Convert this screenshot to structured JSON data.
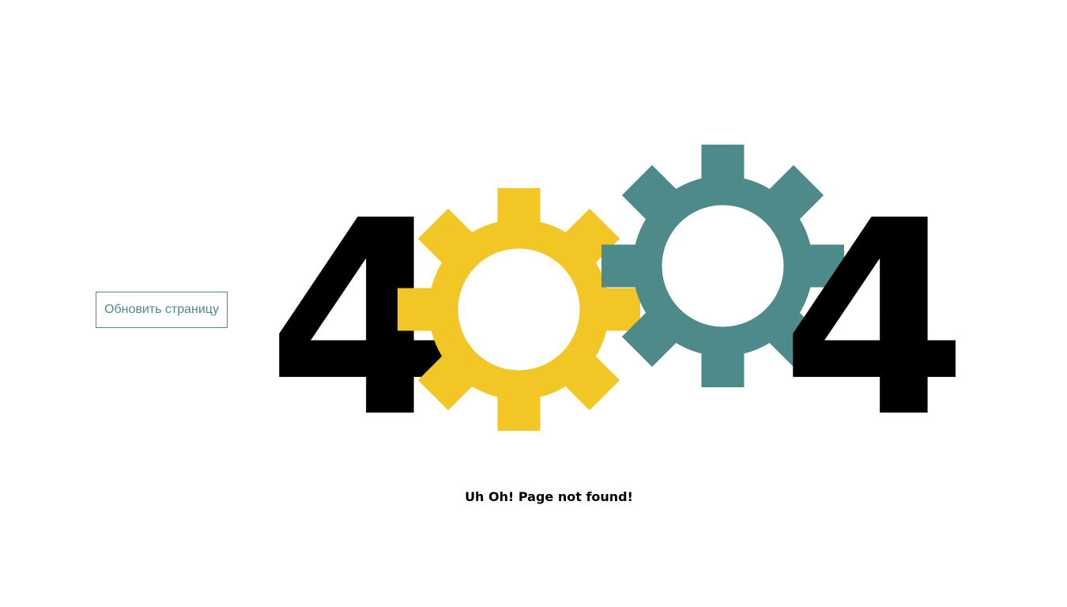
{
  "refresh_button": {
    "label": "Обновить страницу"
  },
  "error": {
    "digit_left": "4",
    "digit_right": "4",
    "message": "Uh Oh! Page not found!"
  },
  "gears": {
    "left": {
      "icon": "gear-icon",
      "color": "#f2c624"
    },
    "right": {
      "icon": "gear-icon",
      "color": "#4f8a8b"
    }
  },
  "colors": {
    "text": "#000000",
    "accent": "#4f8a8b",
    "background": "#ffffff"
  }
}
